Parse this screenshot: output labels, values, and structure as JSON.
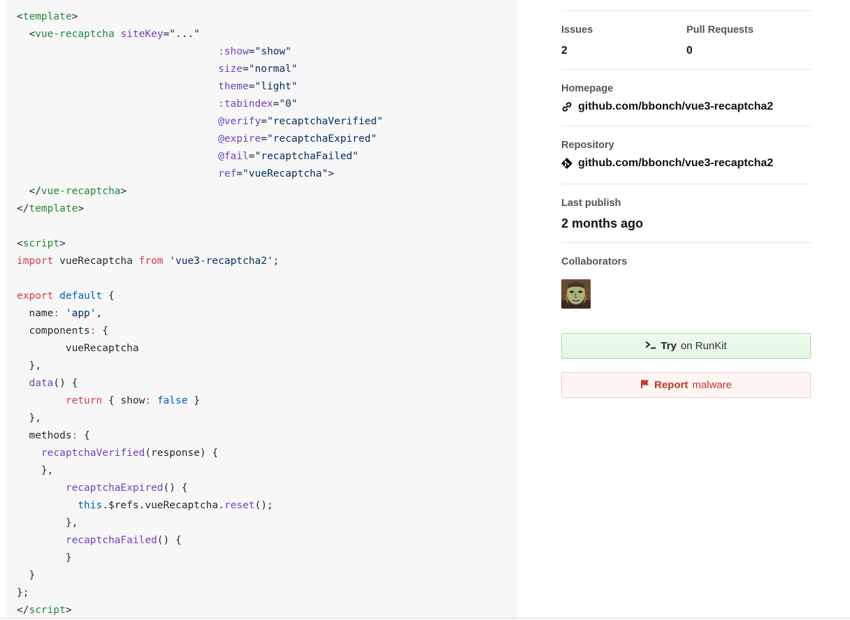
{
  "code": {
    "lines": [
      [
        {
          "c": "t-punc",
          "t": "<"
        },
        {
          "c": "t-tag",
          "t": "template"
        },
        {
          "c": "t-punc",
          "t": ">"
        }
      ],
      [
        {
          "c": "t-punc",
          "t": "  <"
        },
        {
          "c": "t-tag",
          "t": "vue-recaptcha"
        },
        {
          "c": "t-plain",
          "t": " "
        },
        {
          "c": "t-attr",
          "t": "siteKey"
        },
        {
          "c": "t-punc",
          "t": "="
        },
        {
          "c": "t-str",
          "t": "\"...\""
        }
      ],
      [
        {
          "c": "t-plain",
          "t": "                                 "
        },
        {
          "c": "t-attr",
          "t": ":show"
        },
        {
          "c": "t-punc",
          "t": "="
        },
        {
          "c": "t-str",
          "t": "\"show\""
        }
      ],
      [
        {
          "c": "t-plain",
          "t": "                                 "
        },
        {
          "c": "t-attr",
          "t": "size"
        },
        {
          "c": "t-punc",
          "t": "="
        },
        {
          "c": "t-str",
          "t": "\"normal\""
        }
      ],
      [
        {
          "c": "t-plain",
          "t": "                                 "
        },
        {
          "c": "t-attr",
          "t": "theme"
        },
        {
          "c": "t-punc",
          "t": "="
        },
        {
          "c": "t-str",
          "t": "\"light\""
        }
      ],
      [
        {
          "c": "t-plain",
          "t": "                                 "
        },
        {
          "c": "t-attr",
          "t": ":tabindex"
        },
        {
          "c": "t-punc",
          "t": "="
        },
        {
          "c": "t-str",
          "t": "\"0\""
        }
      ],
      [
        {
          "c": "t-plain",
          "t": "                                 "
        },
        {
          "c": "t-attr",
          "t": "@verify"
        },
        {
          "c": "t-punc",
          "t": "="
        },
        {
          "c": "t-str",
          "t": "\"recaptchaVerified\""
        }
      ],
      [
        {
          "c": "t-plain",
          "t": "                                 "
        },
        {
          "c": "t-attr",
          "t": "@expire"
        },
        {
          "c": "t-punc",
          "t": "="
        },
        {
          "c": "t-str",
          "t": "\"recaptchaExpired\""
        }
      ],
      [
        {
          "c": "t-plain",
          "t": "                                 "
        },
        {
          "c": "t-attr",
          "t": "@fail"
        },
        {
          "c": "t-punc",
          "t": "="
        },
        {
          "c": "t-str",
          "t": "\"recaptchaFailed\""
        }
      ],
      [
        {
          "c": "t-plain",
          "t": "                                 "
        },
        {
          "c": "t-attr",
          "t": "ref"
        },
        {
          "c": "t-punc",
          "t": "="
        },
        {
          "c": "t-str",
          "t": "\"vueRecaptcha\""
        },
        {
          "c": "t-punc",
          "t": ">"
        }
      ],
      [
        {
          "c": "t-punc",
          "t": "  </"
        },
        {
          "c": "t-tag",
          "t": "vue-recaptcha"
        },
        {
          "c": "t-punc",
          "t": ">"
        }
      ],
      [
        {
          "c": "t-punc",
          "t": "</"
        },
        {
          "c": "t-tag",
          "t": "template"
        },
        {
          "c": "t-punc",
          "t": ">"
        }
      ],
      [],
      [
        {
          "c": "t-punc",
          "t": "<"
        },
        {
          "c": "t-tag",
          "t": "script"
        },
        {
          "c": "t-punc",
          "t": ">"
        }
      ],
      [
        {
          "c": "t-kw",
          "t": "import"
        },
        {
          "c": "t-plain",
          "t": " vueRecaptcha "
        },
        {
          "c": "t-kw",
          "t": "from"
        },
        {
          "c": "t-plain",
          "t": " "
        },
        {
          "c": "t-str",
          "t": "'vue3-recaptcha2'"
        },
        {
          "c": "t-punc",
          "t": ";"
        }
      ],
      [],
      [
        {
          "c": "t-kw",
          "t": "export"
        },
        {
          "c": "t-plain",
          "t": " "
        },
        {
          "c": "t-blue",
          "t": "default"
        },
        {
          "c": "t-plain",
          "t": " {"
        }
      ],
      [
        {
          "c": "t-plain",
          "t": "  name"
        },
        {
          "c": "t-kw",
          "t": ":"
        },
        {
          "c": "t-plain",
          "t": " "
        },
        {
          "c": "t-str",
          "t": "'app'"
        },
        {
          "c": "t-punc",
          "t": ","
        }
      ],
      [
        {
          "c": "t-plain",
          "t": "  components"
        },
        {
          "c": "t-kw",
          "t": ":"
        },
        {
          "c": "t-plain",
          "t": " {"
        }
      ],
      [
        {
          "c": "t-plain",
          "t": "        vueRecaptcha"
        }
      ],
      [
        {
          "c": "t-plain",
          "t": "  },"
        }
      ],
      [
        {
          "c": "t-plain",
          "t": "  "
        },
        {
          "c": "t-attr",
          "t": "data"
        },
        {
          "c": "t-plain",
          "t": "() {"
        }
      ],
      [
        {
          "c": "t-plain",
          "t": "        "
        },
        {
          "c": "t-kw",
          "t": "return"
        },
        {
          "c": "t-plain",
          "t": " { show"
        },
        {
          "c": "t-kw",
          "t": ":"
        },
        {
          "c": "t-plain",
          "t": " "
        },
        {
          "c": "t-blue",
          "t": "false"
        },
        {
          "c": "t-plain",
          "t": " }"
        }
      ],
      [
        {
          "c": "t-plain",
          "t": "  },"
        }
      ],
      [
        {
          "c": "t-plain",
          "t": "  methods"
        },
        {
          "c": "t-kw",
          "t": ":"
        },
        {
          "c": "t-plain",
          "t": " {"
        }
      ],
      [
        {
          "c": "t-plain",
          "t": "    "
        },
        {
          "c": "t-attr",
          "t": "recaptchaVerified"
        },
        {
          "c": "t-plain",
          "t": "(response) {"
        }
      ],
      [
        {
          "c": "t-plain",
          "t": "    },"
        }
      ],
      [
        {
          "c": "t-plain",
          "t": "        "
        },
        {
          "c": "t-attr",
          "t": "recaptchaExpired"
        },
        {
          "c": "t-plain",
          "t": "() {"
        }
      ],
      [
        {
          "c": "t-plain",
          "t": "          "
        },
        {
          "c": "t-blue",
          "t": "this"
        },
        {
          "c": "t-plain",
          "t": ".$refs.vueRecaptcha."
        },
        {
          "c": "t-attr",
          "t": "reset"
        },
        {
          "c": "t-plain",
          "t": "();"
        }
      ],
      [
        {
          "c": "t-plain",
          "t": "        },"
        }
      ],
      [
        {
          "c": "t-plain",
          "t": "        "
        },
        {
          "c": "t-attr",
          "t": "recaptchaFailed"
        },
        {
          "c": "t-plain",
          "t": "() {"
        }
      ],
      [
        {
          "c": "t-plain",
          "t": "        }"
        }
      ],
      [
        {
          "c": "t-plain",
          "t": "  }"
        }
      ],
      [
        {
          "c": "t-plain",
          "t": "};"
        }
      ],
      [
        {
          "c": "t-punc",
          "t": "</"
        },
        {
          "c": "t-tag",
          "t": "script"
        },
        {
          "c": "t-punc",
          "t": ">"
        }
      ]
    ]
  },
  "sidebar": {
    "issues": {
      "label": "Issues",
      "value": "2"
    },
    "pull_requests": {
      "label": "Pull Requests",
      "value": "0"
    },
    "homepage": {
      "label": "Homepage",
      "value": "github.com/bbonch/vue3-recaptcha2",
      "icon": "link-icon"
    },
    "repository": {
      "label": "Repository",
      "value": "github.com/bbonch/vue3-recaptcha2",
      "icon": "git-icon"
    },
    "last_publish": {
      "label": "Last publish",
      "value": "2 months ago"
    },
    "collaborators": {
      "label": "Collaborators",
      "avatar_icon": "collaborator-avatar"
    },
    "try_runkit": {
      "bold": "Try",
      "rest": "on RunKit",
      "icon": "terminal-icon"
    },
    "report_malware": {
      "bold": "Report",
      "rest": "malware",
      "icon": "flag-icon"
    }
  }
}
